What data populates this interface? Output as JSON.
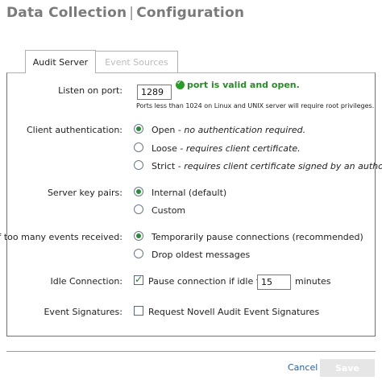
{
  "header": {
    "title_part1": "Data Collection",
    "separator": "|",
    "title_part2": "Configuration"
  },
  "tabs": [
    {
      "label": "Audit Server",
      "active": true
    },
    {
      "label": "Event Sources",
      "active": false
    }
  ],
  "listen_port": {
    "label": "Listen on port:",
    "value": "1289",
    "status": "port is valid and open.",
    "note": "Ports less than 1024 on Linux and UNIX server will require root privileges."
  },
  "client_auth": {
    "label": "Client authentication:",
    "options": [
      {
        "name": "Open",
        "desc": "no authentication required.",
        "selected": true
      },
      {
        "name": "Loose",
        "desc": "requires client certificate.",
        "selected": false
      },
      {
        "name": "Strict",
        "desc": "requires client certificate signed by an authority.",
        "selected": false
      }
    ],
    "dash": "-"
  },
  "server_keys": {
    "label": "Server key pairs:",
    "options": [
      {
        "name": "Internal (default)",
        "selected": true
      },
      {
        "name": "Custom",
        "selected": false
      }
    ]
  },
  "too_many": {
    "label": "If too many events received:",
    "options": [
      {
        "name": "Temporarily pause connections (recommended)",
        "selected": true
      },
      {
        "name": "Drop oldest messages",
        "selected": false
      }
    ]
  },
  "idle": {
    "label": "Idle Connection:",
    "checkbox_label": "Pause connection if idle for",
    "checked": true,
    "value": "15",
    "unit": "minutes"
  },
  "signatures": {
    "label": "Event Signatures:",
    "checkbox_label": "Request Novell Audit Event Signatures",
    "checked": false
  },
  "footer": {
    "cancel_label": "Cancel",
    "save_label": "Save"
  },
  "colors": {
    "accent_green": "#2a8a2a",
    "link_blue": "#2a5f9a",
    "title_gray": "#7a7a7a"
  }
}
